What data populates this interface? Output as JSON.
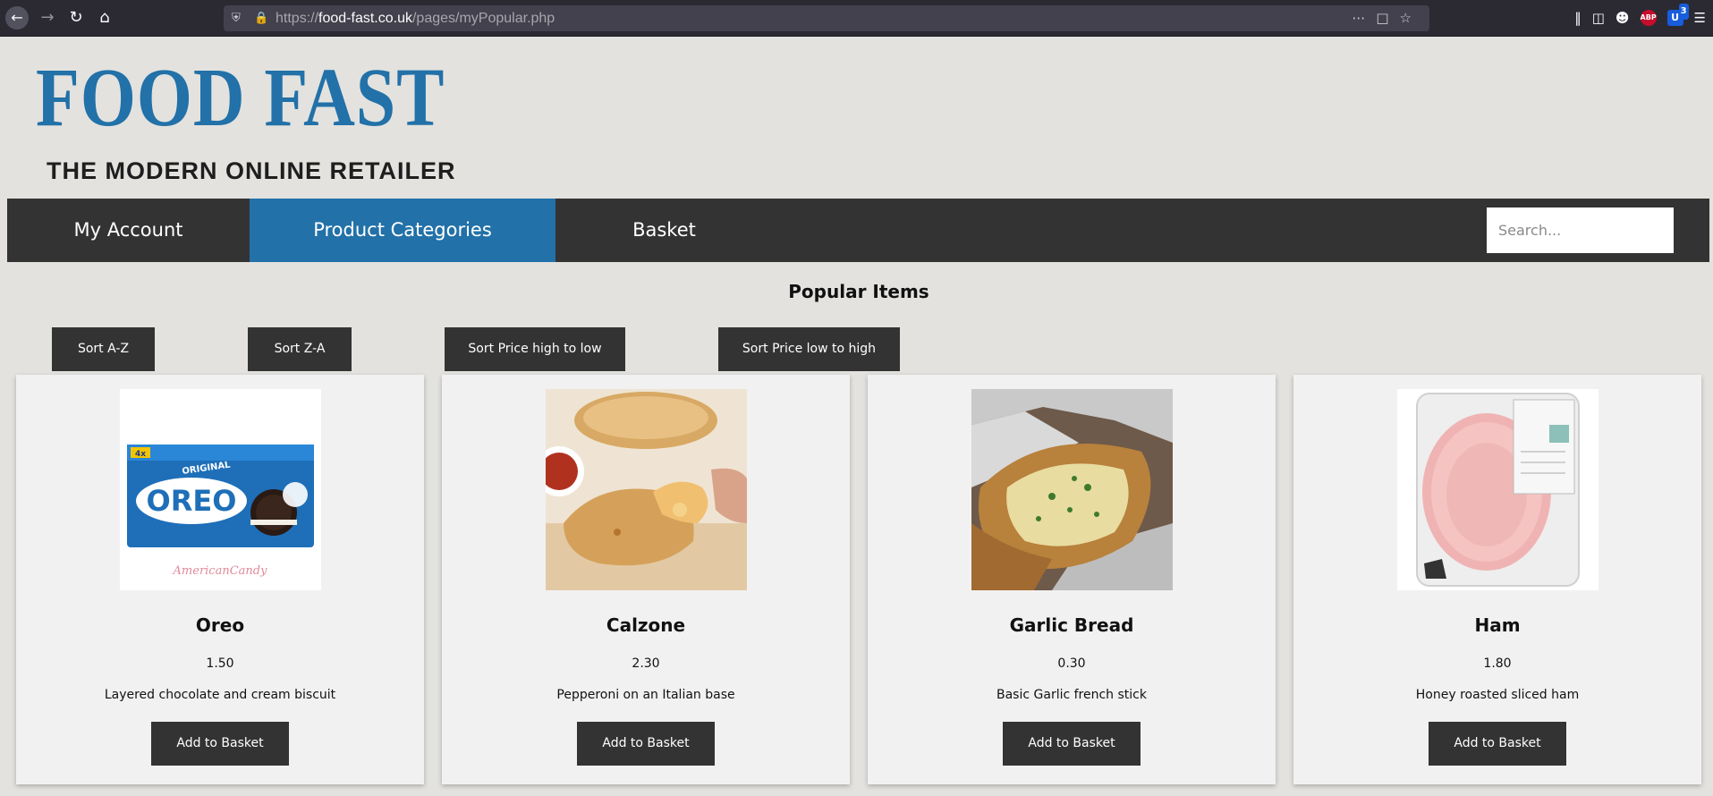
{
  "browser": {
    "url_scheme": "https://",
    "url_host": "food-fast.co.uk",
    "url_path": "/pages/myPopular.php",
    "icons": [
      "back-icon",
      "forward-icon",
      "reload-icon",
      "home-icon",
      "shield-icon",
      "lock-icon",
      "more-icon",
      "pocket-icon",
      "bookmark-star-icon",
      "library-icon",
      "sidebar-icon",
      "account-icon",
      "adblock-icon",
      "bitwarden-icon",
      "menu-icon"
    ],
    "abp_label": "ABP",
    "bitwarden_badge": "3"
  },
  "header": {
    "logo": "FOOD FAST",
    "tagline": "THE MODERN ONLINE RETAILER",
    "logo_color": "#2271a8"
  },
  "nav": {
    "items": [
      {
        "label": "My Account"
      },
      {
        "label": "Product Categories",
        "active": true
      },
      {
        "label": "Basket"
      }
    ],
    "search_placeholder": "Search...",
    "bar_color": "#333333"
  },
  "main": {
    "title": "Popular Items",
    "sort_buttons": [
      {
        "label": "Sort A-Z"
      },
      {
        "label": "Sort Z-A"
      },
      {
        "label": "Sort Price high to low"
      },
      {
        "label": "Sort Price low to high"
      }
    ],
    "products": [
      {
        "name": "Oreo",
        "price": "1.50",
        "description": "Layered chocolate and cream biscuit",
        "button": "Add to Basket",
        "image_caption": "AmericanCandy"
      },
      {
        "name": "Calzone",
        "price": "2.30",
        "description": "Pepperoni on an Italian base",
        "button": "Add to Basket"
      },
      {
        "name": "Garlic Bread",
        "price": "0.30",
        "description": "Basic Garlic french stick",
        "button": "Add to Basket"
      },
      {
        "name": "Ham",
        "price": "1.80",
        "description": "Honey roasted sliced ham",
        "button": "Add to Basket"
      }
    ]
  }
}
